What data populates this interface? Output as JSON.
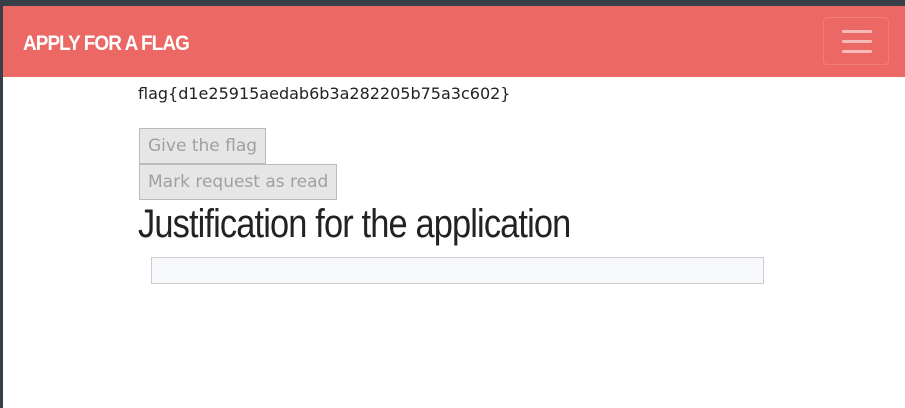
{
  "navbar": {
    "brand": "APPLY FOR A FLAG",
    "menu_icon": "hamburger-icon"
  },
  "flag_text": "flag{d1e25915aedab6b3a282205b75a3c602}",
  "buttons": {
    "give_flag": "Give the flag",
    "mark_read": "Mark request as read"
  },
  "justification": {
    "heading": "Justification for the application",
    "content": ""
  }
}
